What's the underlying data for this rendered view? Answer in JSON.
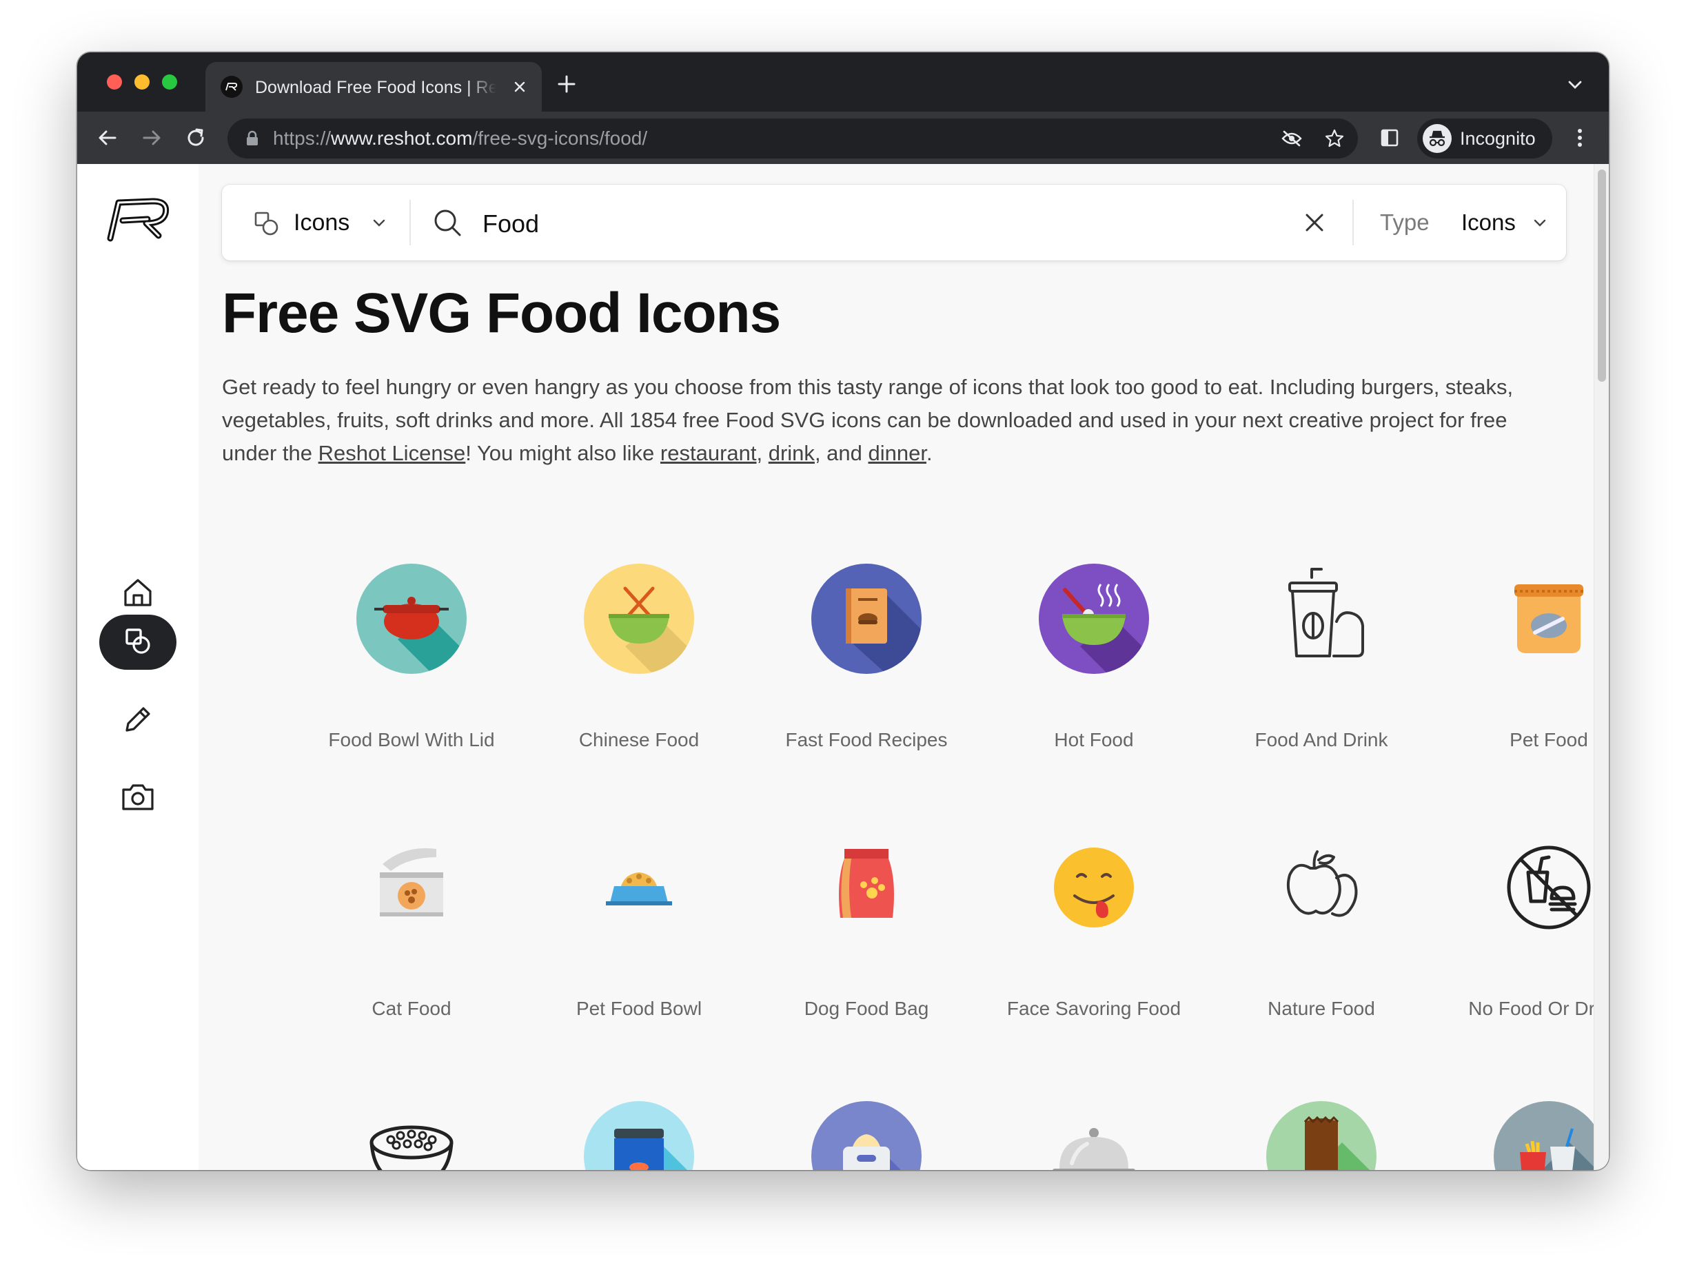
{
  "browser": {
    "tab_title": "Download Free Food Icons | Reshot",
    "url_prefix": "https://",
    "url_host": "www.reshot.com",
    "url_path": "/free-svg-icons/food/",
    "profile_label": "Incognito"
  },
  "search": {
    "category_label": "Icons",
    "query": "Food",
    "type_label": "Type",
    "type_value": "Icons"
  },
  "page": {
    "title": "Free SVG Food Icons",
    "intro_1": "Get ready to feel hungry or even hangry as you choose from this tasty range of icons that look too good to eat. Including burgers, steaks, vegetables, fruits, soft drinks and more. All 1854 free Food SVG icons can be downloaded and used in your next creative project for free under the ",
    "license_link": "Reshot License",
    "intro_2": "! You might also like ",
    "link_restaurant": "restaurant",
    "sep_1": ", ",
    "link_drink": "drink",
    "sep_2": ", and ",
    "link_dinner": "dinner",
    "intro_end": "."
  },
  "icons": [
    {
      "label": "Food Bowl With Lid",
      "icon": "food-bowl-with-lid-icon"
    },
    {
      "label": "Chinese Food",
      "icon": "chinese-food-icon"
    },
    {
      "label": "Fast Food Recipes",
      "icon": "fast-food-recipes-icon"
    },
    {
      "label": "Hot Food",
      "icon": "hot-food-icon"
    },
    {
      "label": "Food And Drink",
      "icon": "food-and-drink-icon"
    },
    {
      "label": "Pet Food",
      "icon": "pet-food-icon"
    },
    {
      "label": "Cat Food",
      "icon": "cat-food-icon"
    },
    {
      "label": "Pet Food Bowl",
      "icon": "pet-food-bowl-icon"
    },
    {
      "label": "Dog Food Bag",
      "icon": "dog-food-bag-icon"
    },
    {
      "label": "Face Savoring Food",
      "icon": "face-savoring-food-icon"
    },
    {
      "label": "Nature Food",
      "icon": "nature-food-icon"
    },
    {
      "label": "No Food Or Drinks",
      "icon": "no-food-or-drinks-icon"
    }
  ],
  "partial_row_icons": [
    "cereal-bowl-icon",
    "fish-food-jar-icon",
    "dog-food-bowl-icon",
    "cloche-icon",
    "kebab-icon",
    "fast-food-meal-icon"
  ],
  "colors": {
    "browser_frame": "#202124",
    "toolbar": "#35363a",
    "page_bg": "#f8f8f8",
    "active_rail": "#222326",
    "text_primary": "#111111",
    "text_secondary": "#666666"
  }
}
